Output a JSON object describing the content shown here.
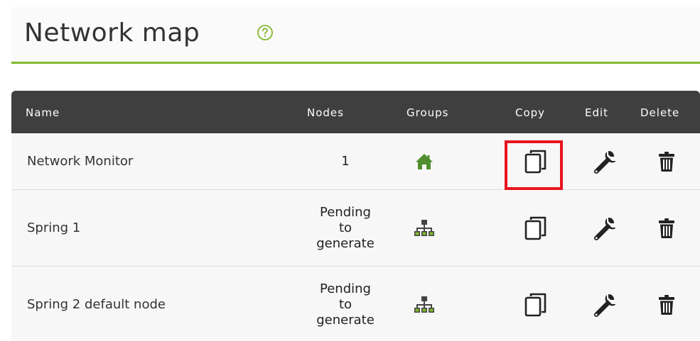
{
  "header": {
    "title": "Network map",
    "help_icon": "help-circle-icon"
  },
  "table": {
    "columns": [
      "Name",
      "Nodes",
      "Groups",
      "Copy",
      "Edit",
      "Delete"
    ],
    "rows": [
      {
        "name": "Network Monitor",
        "nodes_lines": [
          "1"
        ],
        "group_icon": "home-icon"
      },
      {
        "name": "Spring 1",
        "nodes_lines": [
          "Pending",
          "to",
          "generate"
        ],
        "group_icon": "network-tree-icon"
      },
      {
        "name": "Spring 2 default node",
        "nodes_lines": [
          "Pending",
          "to",
          "generate"
        ],
        "group_icon": "network-tree-icon"
      }
    ]
  },
  "colors": {
    "accent": "#82b92e",
    "header_bg": "#3f3f3f",
    "highlight": "#e8141e"
  }
}
